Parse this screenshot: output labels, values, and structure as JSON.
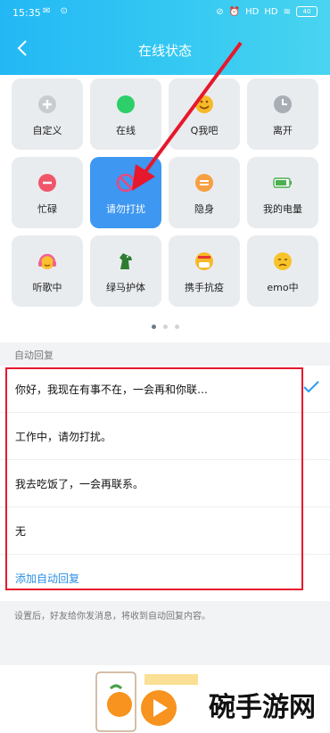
{
  "status_bar": {
    "time": "15:35",
    "network_labels": [
      "HD",
      "HD"
    ],
    "battery": "40"
  },
  "nav": {
    "title": "在线状态"
  },
  "status_tiles": [
    {
      "label": "自定义",
      "icon": "plus-icon",
      "color": "#b9bcbf"
    },
    {
      "label": "在线",
      "icon": "online-dot-icon",
      "color": "#2ccf6a"
    },
    {
      "label": "Q我吧",
      "icon": "smile-face-icon",
      "color": "#f6b928"
    },
    {
      "label": "离开",
      "icon": "clock-icon",
      "color": "#9aa3ab"
    },
    {
      "label": "忙碌",
      "icon": "minus-circle-icon",
      "color": "#f0566a"
    },
    {
      "label": "请勿打扰",
      "icon": "no-entry-icon",
      "color": "#e8497e",
      "selected": true
    },
    {
      "label": "隐身",
      "icon": "hidden-icon",
      "color": "#f7a042"
    },
    {
      "label": "我的电量",
      "icon": "battery-icon",
      "color": "#4caf50"
    },
    {
      "label": "听歌中",
      "icon": "headphone-face-icon",
      "color": "#f48fb1"
    },
    {
      "label": "绿马护体",
      "icon": "green-horse-icon",
      "color": "#2e7d32"
    },
    {
      "label": "携手抗疫",
      "icon": "mask-face-icon",
      "color": "#f6b928"
    },
    {
      "label": "emo中",
      "icon": "sad-face-icon",
      "color": "#f6c42a"
    }
  ],
  "auto_reply": {
    "section_label": "自动回复",
    "items": [
      {
        "text": "你好，我现在有事不在，一会再和你联…",
        "selected": true
      },
      {
        "text": "工作中，请勿打扰。"
      },
      {
        "text": "我去吃饭了，一会再联系。"
      },
      {
        "text": "无"
      }
    ],
    "add_label": "添加自动回复",
    "hint": "设置后，好友给你发消息，将收到自动回复内容。"
  },
  "watermark": {
    "text": "碗手游网"
  }
}
